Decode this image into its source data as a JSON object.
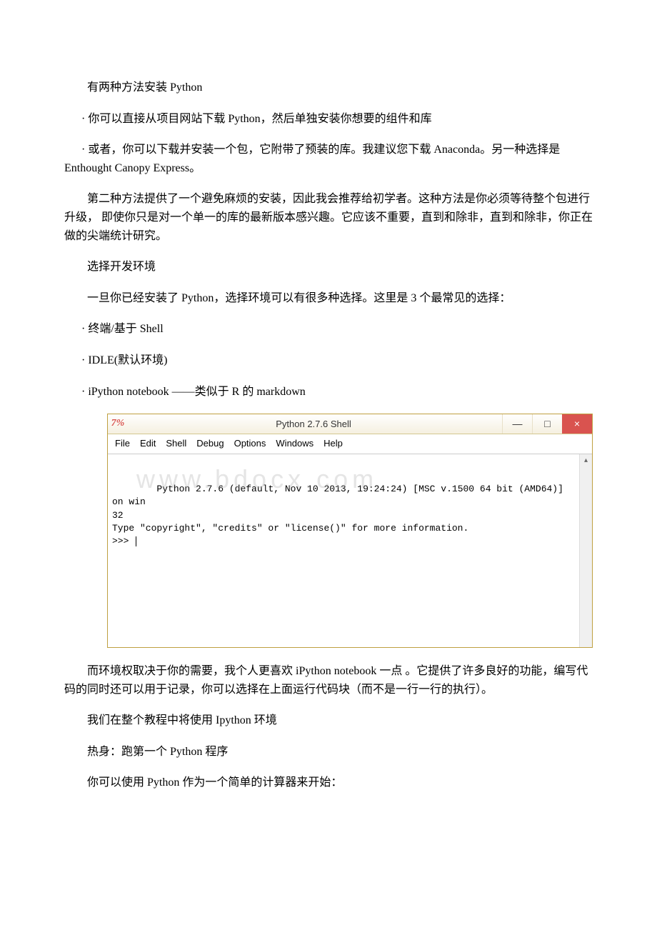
{
  "paragraphs": {
    "p1": "有两种方法安装 Python",
    "p2": "· 你可以直接从项目网站下载 Python，然后单独安装你想要的组件和库",
    "p3": "· 或者，你可以下载并安装一个包，它附带了预装的库。我建议您下载 Anaconda。另一种选择是 Enthought Canopy Express。",
    "p4": "第二种方法提供了一个避免麻烦的安装，因此我会推荐给初学者。这种方法是你必须等待整个包进行升级，  即使你只是对一个单一的库的最新版本感兴趣。它应该不重要，直到和除非，直到和除非，你正在做的尖端统计研究。",
    "p5": "选择开发环境",
    "p6": "一旦你已经安装了 Python，选择环境可以有很多种选择。这里是 3 个最常见的选择：",
    "p7": "· 终端/基于 Shell",
    "p8": "· IDLE(默认环境)",
    "p9": "· iPython notebook ——类似于 R 的 markdown",
    "p10": "而环境权取决于你的需要，我个人更喜欢 iPython notebook 一点 。它提供了许多良好的功能，编写代码的同时还可以用于记录，你可以选择在上面运行代码块（而不是一行一行的执行）。",
    "p11": "我们在整个教程中将使用 Ipython 环境",
    "p12": "热身：跑第一个 Python 程序",
    "p13": "你可以使用 Python 作为一个简单的计算器来开始："
  },
  "window": {
    "title": "Python 2.7.6 Shell",
    "icon_text": "7%",
    "menu": [
      "File",
      "Edit",
      "Shell",
      "Debug",
      "Options",
      "Windows",
      "Help"
    ],
    "console_line1": "Python 2.7.6 (default, Nov 10 2013, 19:24:24) [MSC v.1500 64 bit (AMD64)] on win",
    "console_line2": "32",
    "console_line3": "Type \"copyright\", \"credits\" or \"license()\" for more information.",
    "prompt": ">>>",
    "watermark": "www.bdocx.com",
    "minimize": "—",
    "maximize": "□",
    "close": "×",
    "scroll_up": "▴"
  }
}
